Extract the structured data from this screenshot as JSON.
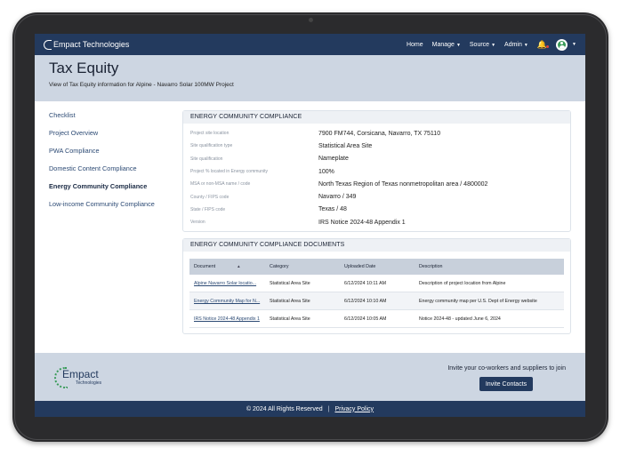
{
  "nav": {
    "brand": "Empact Technologies",
    "links": [
      {
        "label": "Home",
        "has_caret": false
      },
      {
        "label": "Manage",
        "has_caret": true
      },
      {
        "label": "Source",
        "has_caret": true
      },
      {
        "label": "Admin",
        "has_caret": true
      }
    ],
    "bell_icon": "bell-icon",
    "avatar_icon": "user-avatar-icon"
  },
  "hero": {
    "title": "Tax Equity",
    "subtitle": "View of Tax Equity information for Alpine - Navarro Solar 100MW Project"
  },
  "sidebar": {
    "items": [
      {
        "label": "Checklist",
        "active": false
      },
      {
        "label": "Project Overview",
        "active": false
      },
      {
        "label": "PWA Compliance",
        "active": false
      },
      {
        "label": "Domestic Content Compliance",
        "active": false
      },
      {
        "label": "Energy Community Compliance",
        "active": true
      },
      {
        "label": "Low-income Community Compliance",
        "active": false
      }
    ]
  },
  "compliance": {
    "heading": "ENERGY COMMUNITY COMPLIANCE",
    "rows": [
      {
        "label": "Project site location",
        "value": "7900 FM744, Corsicana, Navarro, TX 75110"
      },
      {
        "label": "Site qualification type",
        "value": "Statistical Area Site"
      },
      {
        "label": "Site qualification",
        "value": "Nameplate"
      },
      {
        "label": "Project % located in Energy community",
        "value": "100%"
      },
      {
        "label": "MSA or non-MSA name / code",
        "value": "North Texas Region of Texas nonmetropolitan area / 4800002"
      },
      {
        "label": "County / FIPS code",
        "value": "Navarro / 349"
      },
      {
        "label": "State / FIPS code",
        "value": "Texas / 48"
      },
      {
        "label": "Version",
        "value": "IRS Notice 2024-48 Appendix 1"
      }
    ]
  },
  "documents": {
    "heading": "ENERGY COMMUNITY COMPLIANCE DOCUMENTS",
    "columns": [
      "Document",
      "Category",
      "Uploaded Date",
      "Description"
    ],
    "sort_icon": "sort-ascending-icon",
    "rows": [
      {
        "document": "Alpine Navarro Solar locatio...",
        "category": "Statistical Area Site",
        "uploaded": "6/12/2024 10:11 AM",
        "description": "Description of project location from Alpine"
      },
      {
        "document": "Energy Community Map for N...",
        "category": "Statistical Area Site",
        "uploaded": "6/12/2024 10:10 AM",
        "description": "Energy community map per U.S. Dept of Energy website"
      },
      {
        "document": "IRS Notice 2024-48 Appendix 1",
        "category": "Statistical Area Site",
        "uploaded": "6/12/2024 10:05 AM",
        "description": "Notice 2024-48 - updated June 6, 2024"
      }
    ]
  },
  "footer": {
    "logo_text": "Empact",
    "logo_sub": "Technologies",
    "invite_text": "Invite your co-workers and suppliers to join",
    "invite_button": "Invite Contacts",
    "copyright": "© 2024 All Rights Reserved",
    "separator": "|",
    "privacy": "Privacy Policy"
  }
}
